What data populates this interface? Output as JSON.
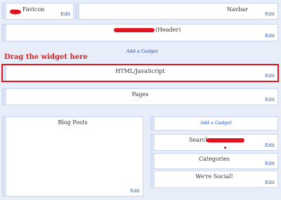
{
  "favicon": {
    "title": "Favicon",
    "edit": "Edit"
  },
  "navbar": {
    "title": "Navbar",
    "edit": "Edit"
  },
  "header": {
    "title_suffix": "(Header)",
    "edit": "Edit"
  },
  "add_gadget_top": "Add a Gadget",
  "drag_hint": "Drag the widget here",
  "html_widget": {
    "title": "HTML/JavaScript",
    "edit": "Edit"
  },
  "pages": {
    "title": "Pages",
    "edit": "Edit"
  },
  "blog_posts": {
    "title": "Blog Posts",
    "edit": "Edit"
  },
  "sidebar": {
    "add_gadget": "Add a Gadget",
    "search": {
      "title": "Search",
      "edit": "Edit"
    },
    "categories": {
      "title": "Categories",
      "edit": "Edit"
    },
    "social": {
      "title": "We're Social!",
      "edit": "Edit"
    }
  },
  "colors": {
    "highlight_border": "#e2161f",
    "link": "#2a4fb0",
    "background": "#e8eef9"
  },
  "icons": {
    "favicon_logo": "red-bird-icon"
  }
}
